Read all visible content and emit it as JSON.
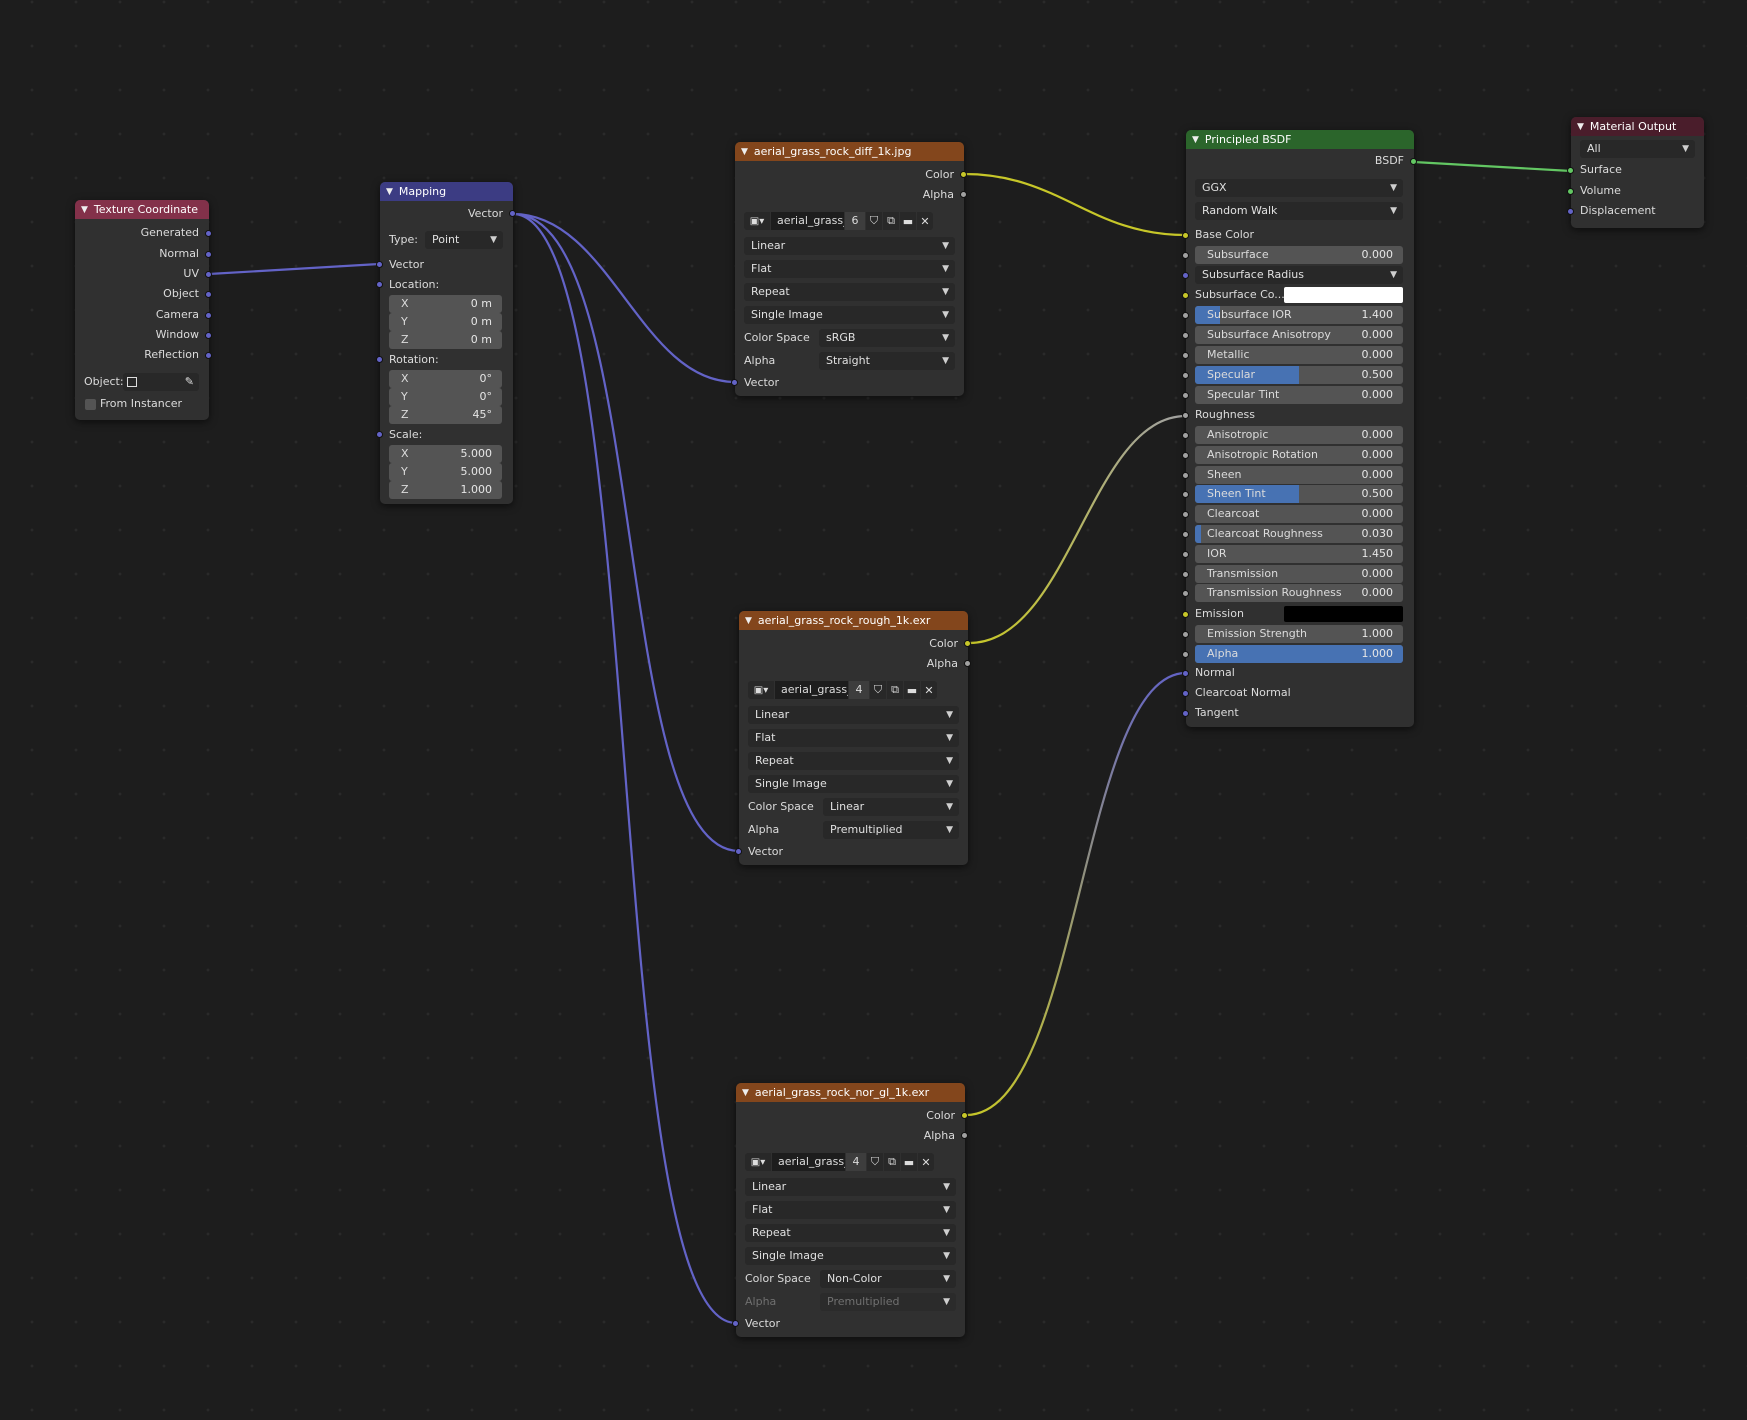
{
  "colors": {
    "background": "#1d1d1d",
    "node_body": "#303030",
    "header_input": "#83314a",
    "header_vector": "#3c3c83",
    "header_texture": "#83461c",
    "header_shader": "#2b652b",
    "header_output": "#4a1d2b",
    "socket_vector": "#6363c7",
    "socket_color": "#c7c729",
    "socket_float": "#a1a1a1",
    "socket_shader": "#63c763",
    "slider_fill": "#4772b3"
  },
  "texture_coordinate": {
    "title": "Texture Coordinate",
    "outputs": [
      "Generated",
      "Normal",
      "UV",
      "Object",
      "Camera",
      "Window",
      "Reflection"
    ],
    "object_label": "Object:",
    "from_instancer": "From Instancer"
  },
  "mapping": {
    "title": "Mapping",
    "output": "Vector",
    "type_label": "Type:",
    "type_value": "Point",
    "vector_input": "Vector",
    "location_label": "Location:",
    "location": [
      {
        "axis": "X",
        "value": "0 m"
      },
      {
        "axis": "Y",
        "value": "0 m"
      },
      {
        "axis": "Z",
        "value": "0 m"
      }
    ],
    "rotation_label": "Rotation:",
    "rotation": [
      {
        "axis": "X",
        "value": "0°"
      },
      {
        "axis": "Y",
        "value": "0°"
      },
      {
        "axis": "Z",
        "value": "45°"
      }
    ],
    "scale_label": "Scale:",
    "scale": [
      {
        "axis": "X",
        "value": "5.000"
      },
      {
        "axis": "Y",
        "value": "5.000"
      },
      {
        "axis": "Z",
        "value": "1.000"
      }
    ]
  },
  "images": [
    {
      "title": "aerial_grass_rock_diff_1k.jpg",
      "out_color": "Color",
      "out_alpha": "Alpha",
      "image_name": "aerial_grass_...",
      "users": "6",
      "interpolation": "Linear",
      "projection": "Flat",
      "extension": "Repeat",
      "source": "Single Image",
      "colorspace_label": "Color Space",
      "colorspace": "sRGB",
      "alpha_label": "Alpha",
      "alpha": "Straight",
      "vector": "Vector"
    },
    {
      "title": "aerial_grass_rock_rough_1k.exr",
      "out_color": "Color",
      "out_alpha": "Alpha",
      "image_name": "aerial_grass_...",
      "users": "4",
      "interpolation": "Linear",
      "projection": "Flat",
      "extension": "Repeat",
      "source": "Single Image",
      "colorspace_label": "Color Space",
      "colorspace": "Linear",
      "alpha_label": "Alpha",
      "alpha": "Premultiplied",
      "vector": "Vector"
    },
    {
      "title": "aerial_grass_rock_nor_gl_1k.exr",
      "out_color": "Color",
      "out_alpha": "Alpha",
      "image_name": "aerial_grass_...",
      "users": "4",
      "interpolation": "Linear",
      "projection": "Flat",
      "extension": "Repeat",
      "source": "Single Image",
      "colorspace_label": "Color Space",
      "colorspace": "Non-Color",
      "alpha_label": "Alpha",
      "alpha": "Premultiplied",
      "vector": "Vector"
    }
  ],
  "bsdf": {
    "title": "Principled BSDF",
    "output": "BSDF",
    "distribution": "GGX",
    "subsurface_method": "Random Walk",
    "base_color": "Base Color",
    "subsurface": {
      "label": "Subsurface",
      "value": "0.000",
      "fill": 0.0
    },
    "subsurface_radius": "Subsurface Radius",
    "subsurface_color": "Subsurface Co...",
    "sliders_a": [
      {
        "label": "Subsurface IOR",
        "value": "1.400",
        "fill": 0.12
      },
      {
        "label": "Subsurface Anisotropy",
        "value": "0.000",
        "fill": 0.0
      },
      {
        "label": "Metallic",
        "value": "0.000",
        "fill": 0.0
      },
      {
        "label": "Specular",
        "value": "0.500",
        "fill": 0.5
      },
      {
        "label": "Specular Tint",
        "value": "0.000",
        "fill": 0.0
      }
    ],
    "roughness": "Roughness",
    "sliders_b": [
      {
        "label": "Anisotropic",
        "value": "0.000",
        "fill": 0.0
      },
      {
        "label": "Anisotropic Rotation",
        "value": "0.000",
        "fill": 0.0
      },
      {
        "label": "Sheen",
        "value": "0.000",
        "fill": 0.0
      },
      {
        "label": "Sheen Tint",
        "value": "0.500",
        "fill": 0.5
      },
      {
        "label": "Clearcoat",
        "value": "0.000",
        "fill": 0.0
      },
      {
        "label": "Clearcoat Roughness",
        "value": "0.030",
        "fill": 0.03
      },
      {
        "label": "IOR",
        "value": "1.450",
        "fill": 0.0
      },
      {
        "label": "Transmission",
        "value": "0.000",
        "fill": 0.0
      },
      {
        "label": "Transmission Roughness",
        "value": "0.000",
        "fill": 0.0
      }
    ],
    "emission": "Emission",
    "emission_strength": {
      "label": "Emission Strength",
      "value": "1.000",
      "fill": 0.0
    },
    "alpha": {
      "label": "Alpha",
      "value": "1.000",
      "fill": 1.0
    },
    "normal": "Normal",
    "clearcoat_normal": "Clearcoat Normal",
    "tangent": "Tangent"
  },
  "output": {
    "title": "Material Output",
    "target": "All",
    "inputs": [
      "Surface",
      "Volume",
      "Displacement"
    ]
  }
}
